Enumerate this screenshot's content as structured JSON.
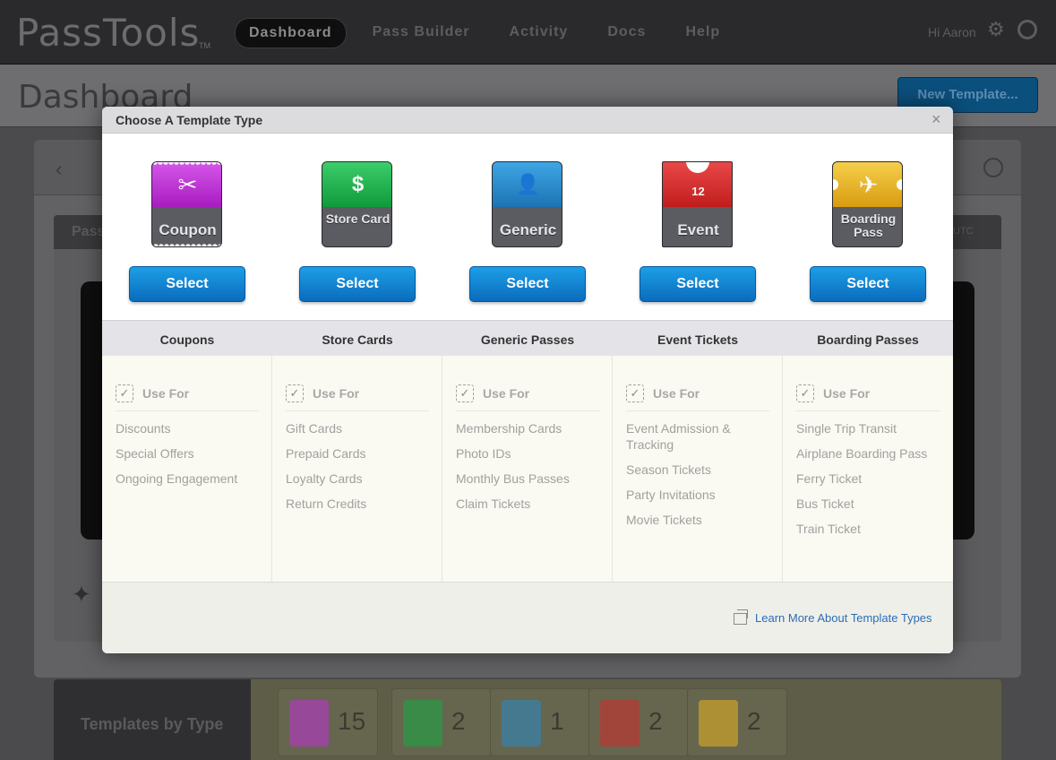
{
  "app": {
    "logo": "PassTools",
    "logo_tm": "TM",
    "nav": [
      "Dashboard",
      "Pass Builder",
      "Activity",
      "Docs",
      "Help"
    ],
    "greeting": "Hi Aaron",
    "icons": {
      "settings": "gear-icon",
      "logout": "logout-icon"
    }
  },
  "page": {
    "title": "Dashboard",
    "new_template_button": "New Template...",
    "panel_label": "Pass",
    "panel_timezone": "UTC",
    "templates_by_type": {
      "label": "Templates by Type",
      "items": [
        {
          "type": "coupon",
          "count": "15",
          "icon": "scissors-icon"
        },
        {
          "type": "store-card",
          "count": "2",
          "icon": "dollar-icon"
        },
        {
          "type": "generic",
          "count": "1",
          "icon": "person-icon"
        },
        {
          "type": "event",
          "count": "2",
          "icon": "calendar-icon"
        },
        {
          "type": "boarding-pass",
          "count": "2",
          "icon": "airplane-icon"
        }
      ]
    }
  },
  "modal": {
    "title": "Choose A Template Type",
    "close_glyph": "×",
    "select_label": "Select",
    "use_for_label": "Use For",
    "use_for_check": "✓",
    "learn_more": "Learn More About Template Types",
    "columns": [
      {
        "id": "coupon",
        "pass_label": "Coupon",
        "name": "Coupons",
        "icon": "scissors-icon",
        "glyph": "✂",
        "color": "#c02fd6",
        "uses": [
          "Discounts",
          "Special Offers",
          "Ongoing Engagement"
        ]
      },
      {
        "id": "store-card",
        "pass_label": "Store Card",
        "name": "Store Cards",
        "icon": "dollar-icon",
        "glyph": "$",
        "color": "#15a843",
        "uses": [
          "Gift Cards",
          "Prepaid Cards",
          "Loyalty Cards",
          "Return Credits"
        ]
      },
      {
        "id": "generic",
        "pass_label": "Generic",
        "name": "Generic Passes",
        "icon": "person-icon",
        "glyph": "👤",
        "color": "#2a88c7",
        "uses": [
          "Membership Cards",
          "Photo IDs",
          "Monthly Bus Passes",
          "Claim Tickets"
        ]
      },
      {
        "id": "event",
        "pass_label": "Event",
        "name": "Event Tickets",
        "icon": "calendar-icon",
        "glyph": "12",
        "color": "#d22a2a",
        "uses": [
          "Event Admission & Tracking",
          "Season Tickets",
          "Party Invitations",
          "Movie Tickets"
        ]
      },
      {
        "id": "boarding-pass",
        "pass_label": "Boarding Pass",
        "name": "Boarding Passes",
        "icon": "airplane-icon",
        "glyph": "✈",
        "color": "#e9b21f",
        "uses": [
          "Single Trip Transit",
          "Airplane Boarding Pass",
          "Ferry Ticket",
          "Bus Ticket",
          "Train Ticket"
        ]
      }
    ]
  }
}
